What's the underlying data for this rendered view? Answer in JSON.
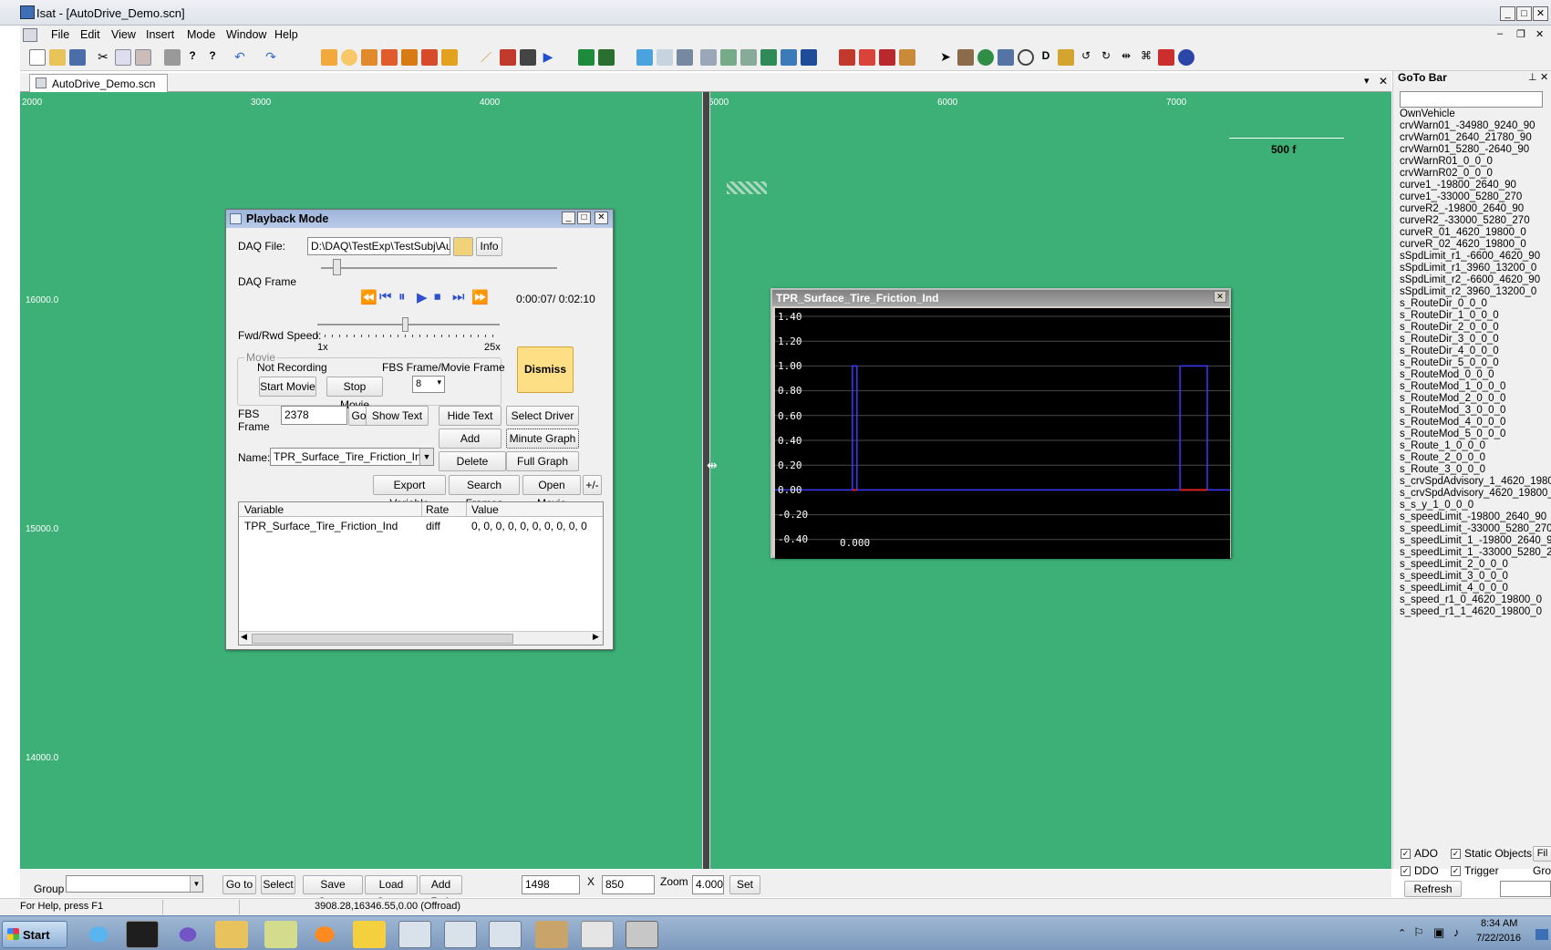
{
  "window": {
    "title": "Isat - [AutoDrive_Demo.scn]",
    "minimize": "_",
    "maximize": "□",
    "close": "✕"
  },
  "menu": [
    "File",
    "Edit",
    "View",
    "Insert",
    "Mode",
    "Window",
    "Help"
  ],
  "document_tab": "AutoDrive_Demo.scn",
  "canvas": {
    "x_ruler": [
      "2000",
      "3000",
      "4000",
      "5000",
      "6000",
      "7000"
    ],
    "y_ruler": [
      "16000.0",
      "15000.0",
      "14000.0"
    ],
    "scale_label": "500 f"
  },
  "playback": {
    "title": "Playback Mode",
    "daq_file_label": "DAQ File:",
    "daq_file_value": "D:\\DAQ\\TestExp\\TestSubj\\Auto",
    "info_button": "Info",
    "daq_frame_label": "DAQ Frame",
    "time": "0:00:07/ 0:02:10",
    "speed_label": "Fwd/Rwd Speed:",
    "speed_min": "1x",
    "speed_max": "25x",
    "movie_group": "Movie",
    "movie_status": "Not Recording",
    "fbs_movie_label": "FBS Frame/Movie Frame",
    "fbs_movie_value": "8",
    "start_movie": "Start Movie",
    "stop_movie": "Stop Movie",
    "dismiss": "Dismiss",
    "fbs_frame_label_1": "FBS",
    "fbs_frame_label_2": "Frame",
    "fbs_frame_value": "2378",
    "go": "Go",
    "show_text": "Show Text",
    "hide_text": "Hide Text",
    "select_driver": "Select Driver",
    "add_variable": "Add Variable",
    "minute_graph": "Minute Graph",
    "name_label": "Name:",
    "name_value": "TPR_Surface_Tire_Friction_Ind",
    "delete_variable": "Delete Variable",
    "full_graph": "Full Graph",
    "export_variable": "Export Variable",
    "search_frames": "Search Frames",
    "open_movie": "Open Movie",
    "plus_minus": "+/-",
    "table_headers": [
      "Variable",
      "Rate",
      "Value"
    ],
    "table_rows": [
      {
        "variable": "TPR_Surface_Tire_Friction_Ind",
        "rate": "diff",
        "value": "0, 0, 0, 0, 0, 0, 0, 0, 0, 0"
      }
    ]
  },
  "graph": {
    "title": "TPR_Surface_Tire_Friction_Ind",
    "close": "✕",
    "y_labels": [
      "1.40",
      "1.20",
      "1.00",
      "0.80",
      "0.60",
      "0.40",
      "0.20",
      "0.00",
      "-0.20",
      "-0.40"
    ],
    "x_label": "0.000"
  },
  "chart_data": {
    "type": "line",
    "title": "TPR_Surface_Tire_Friction_Ind",
    "ylim": [
      -0.4,
      1.4
    ],
    "x_tick_labels": [
      "0.000"
    ],
    "series": [
      {
        "name": "",
        "color": "#3a3aff",
        "pulses": [
          {
            "from": 0.17,
            "to": 0.18,
            "level": 1.0
          },
          {
            "from": 0.89,
            "to": 0.95,
            "level": 1.0
          }
        ],
        "baseline": 0.0
      }
    ]
  },
  "goto_bar": {
    "title": "GoTo Bar",
    "search_value": "",
    "items": [
      "OwnVehicle",
      "crvWarn01_-34980_9240_90",
      "crvWarn01_2640_21780_90",
      "crvWarn01_5280_-2640_90",
      "crvWarnR01_0_0_0",
      "crvWarnR02_0_0_0",
      "curve1_-19800_2640_90",
      "curve1_-33000_5280_270",
      "curveR2_-19800_2640_90",
      "curveR2_-33000_5280_270",
      "curveR_01_4620_19800_0",
      "curveR_02_4620_19800_0",
      "sSpdLimit_r1_-6600_4620_90",
      "sSpdLimit_r1_3960_13200_0",
      "sSpdLimit_r2_-6600_4620_90",
      "sSpdLimit_r2_3960_13200_0",
      "s_RouteDir_0_0_0",
      "s_RouteDir_1_0_0_0",
      "s_RouteDir_2_0_0_0",
      "s_RouteDir_3_0_0_0",
      "s_RouteDir_4_0_0_0",
      "s_RouteDir_5_0_0_0",
      "s_RouteMod_0_0_0",
      "s_RouteMod_1_0_0_0",
      "s_RouteMod_2_0_0_0",
      "s_RouteMod_3_0_0_0",
      "s_RouteMod_4_0_0_0",
      "s_RouteMod_5_0_0_0",
      "s_Route_1_0_0_0",
      "s_Route_2_0_0_0",
      "s_Route_3_0_0_0",
      "s_crvSpdAdvisory_1_4620_1980",
      "s_crvSpdAdvisory_4620_19800_",
      "s_s_y_1_0_0_0",
      "s_speedLimit_-19800_2640_90",
      "s_speedLimit_-33000_5280_270",
      "s_speedLimit_1_-19800_2640_9",
      "s_speedLimit_1_-33000_5280_2",
      "s_speedLimit_2_0_0_0",
      "s_speedLimit_3_0_0_0",
      "s_speedLimit_4_0_0_0",
      "s_speed_r1_0_4620_19800_0",
      "s_speed_r1_1_4620_19800_0"
    ],
    "ado": "ADO",
    "static_objects": "Static Objects",
    "fil": "Fil",
    "ddo": "DDO",
    "trigger": "Trigger",
    "gro": "Gro",
    "refresh": "Refresh"
  },
  "bottom": {
    "group_label": "Group",
    "goto": "Go to",
    "select": "Select",
    "save_group": "Save Group",
    "load_group": "Load Group",
    "add_ref": "Add Ref.",
    "x_value": "1498",
    "x_sep": "X",
    "y_value": "850",
    "zoom_label": "Zoom",
    "zoom_value": "4.000",
    "set": "Set"
  },
  "status": {
    "help": "For Help, press F1",
    "coords": "3908.28,16346.55,0.00 (Offroad)"
  },
  "taskbar": {
    "start": "Start",
    "time": "8:34 AM",
    "date": "7/22/2016"
  }
}
